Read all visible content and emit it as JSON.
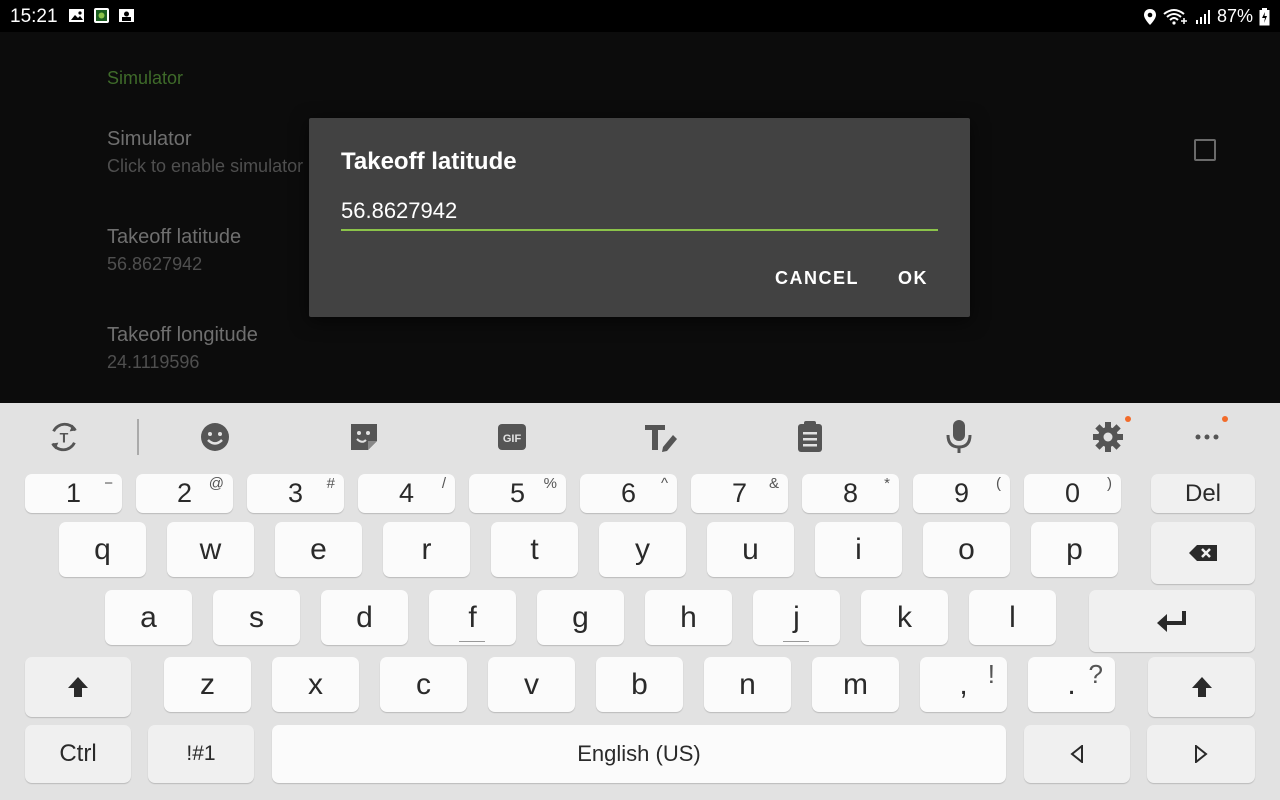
{
  "status_bar": {
    "time": "15:21",
    "battery": "87%"
  },
  "settings": {
    "category": "Simulator",
    "items": [
      {
        "title": "Simulator",
        "summary": "Click to enable simulator"
      },
      {
        "title": "Takeoff latitude",
        "summary": "56.8627942"
      },
      {
        "title": "Takeoff longitude",
        "summary": "24.1119596"
      }
    ]
  },
  "dialog": {
    "title": "Takeoff latitude",
    "value": "56.8627942",
    "cancel_label": "CANCEL",
    "ok_label": "OK"
  },
  "keyboard": {
    "number_row": [
      {
        "main": "1",
        "sup": "−"
      },
      {
        "main": "2",
        "sup": "@"
      },
      {
        "main": "3",
        "sup": "#"
      },
      {
        "main": "4",
        "sup": "/"
      },
      {
        "main": "5",
        "sup": "%"
      },
      {
        "main": "6",
        "sup": "^"
      },
      {
        "main": "7",
        "sup": "&"
      },
      {
        "main": "8",
        "sup": "*"
      },
      {
        "main": "9",
        "sup": "("
      },
      {
        "main": "0",
        "sup": ")"
      }
    ],
    "del_label": "Del",
    "row1": [
      "q",
      "w",
      "e",
      "r",
      "t",
      "y",
      "u",
      "i",
      "o",
      "p"
    ],
    "row2": [
      "a",
      "s",
      "d",
      "f",
      "g",
      "h",
      "j",
      "k",
      "l"
    ],
    "row3": [
      "z",
      "x",
      "c",
      "v",
      "b",
      "n",
      "m"
    ],
    "comma": {
      "main": ",",
      "sup": "!"
    },
    "period": {
      "main": ".",
      "sup": "?"
    },
    "ctrl_label": "Ctrl",
    "symbols_label": "!#1",
    "space_label": "English (US)"
  }
}
